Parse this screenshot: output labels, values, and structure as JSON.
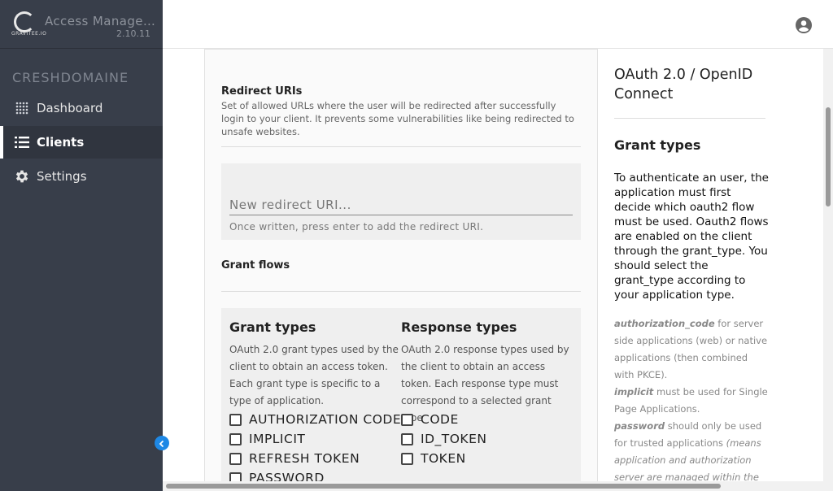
{
  "brand": {
    "logo_text": "GRAVITEE.IO",
    "title": "Access Manage…",
    "version": "2.10.11"
  },
  "sidebar": {
    "domain": "CRESHDOMAINE",
    "items": [
      {
        "label": "Dashboard",
        "icon": "grid-icon",
        "active": false
      },
      {
        "label": "Clients",
        "icon": "list-icon",
        "active": true
      },
      {
        "label": "Settings",
        "icon": "gear-icon",
        "active": false
      }
    ]
  },
  "topbar": {
    "avatar_icon": "account-circle-icon"
  },
  "redirect": {
    "title": "Redirect URIs",
    "description": "Set of allowed URLs where the user will be redirected after successfully login to your client. It prevents some vulnerabilities like being redirected to unsafe websites.",
    "placeholder": "New redirect URI...",
    "hint": "Once written, press enter to add the redirect URI."
  },
  "grant_flows": {
    "title": "Grant flows"
  },
  "grant_types": {
    "title": "Grant types",
    "description": "OAuth 2.0 grant types used by the client to obtain an access token. Each grant type is specific to a type of application.",
    "options": [
      {
        "label": "AUTHORIZATION CODE",
        "checked": false
      },
      {
        "label": "IMPLICIT",
        "checked": false
      },
      {
        "label": "REFRESH TOKEN",
        "checked": false
      },
      {
        "label": "PASSWORD",
        "checked": false
      }
    ]
  },
  "response_types": {
    "title": "Response types",
    "description": "OAuth 2.0 response types used by the client to obtain an access token. Each response type must correspond to a selected grant type",
    "options": [
      {
        "label": "CODE",
        "checked": false
      },
      {
        "label": "ID_TOKEN",
        "checked": false
      },
      {
        "label": "TOKEN",
        "checked": false
      }
    ]
  },
  "help": {
    "title": "OAuth 2.0 / OpenID Connect",
    "subtitle": "Grant types",
    "text": "To authenticate an user, the application must first decide which oauth2 flow must be used. Oauth2 flows are enabled on the client through the grant_type. You should select the grant_type according to your application type.",
    "items": [
      {
        "term": "authorization_code",
        "desc": " for server side applications (web) or native applications (then combined with PKCE)."
      },
      {
        "term": "implicit",
        "desc": " must be used for Single Page Applications."
      },
      {
        "term": "password",
        "desc": " should only be used for trusted applications ",
        "note": "(means application and authorization server are managed within the"
      }
    ]
  },
  "colors": {
    "sidebar": "#383e4a",
    "accent": "#1e88e5"
  }
}
